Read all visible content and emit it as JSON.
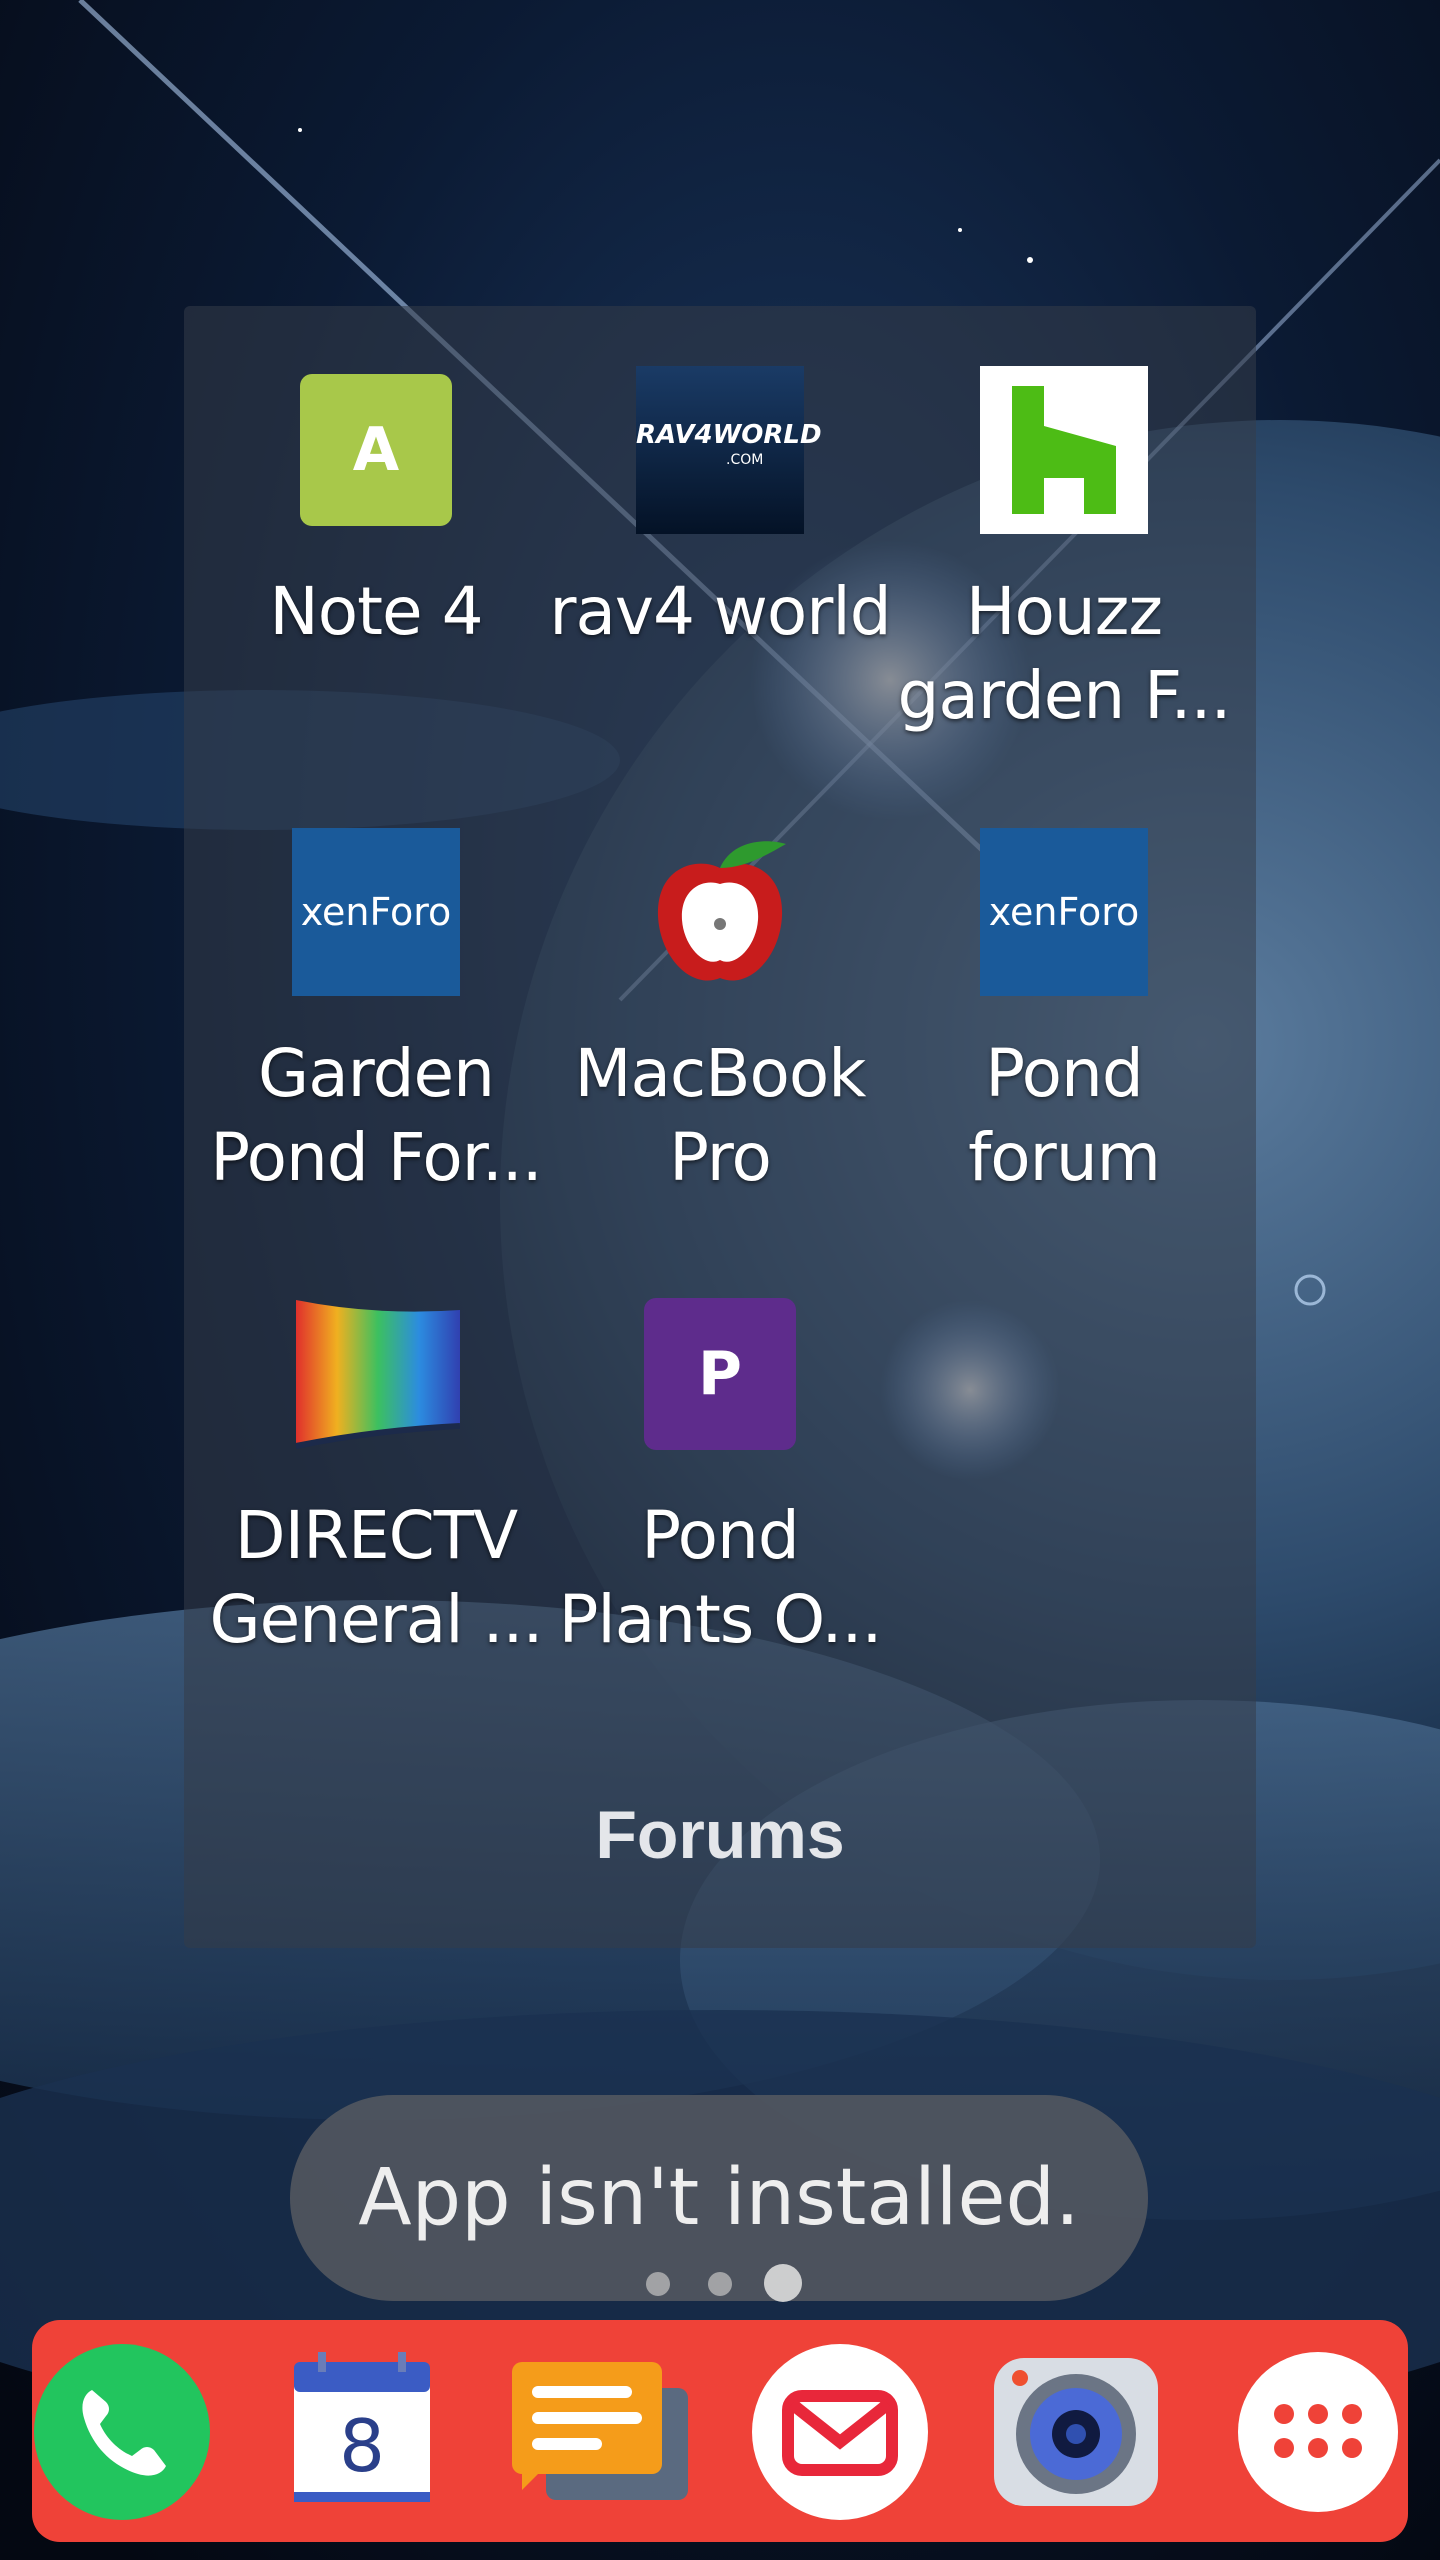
{
  "folder": {
    "name": "Forums",
    "apps": [
      {
        "label": "Note 4",
        "icon": "letter-a-icon",
        "letter": "A"
      },
      {
        "label": "rav4 world",
        "icon": "rav4world-icon",
        "logo_text": "RAV4WORLD",
        "logo_sub": ".COM"
      },
      {
        "label": "Houzz\ngarden F...",
        "icon": "houzz-icon"
      },
      {
        "label": "Garden\nPond For...",
        "icon": "xenforo-icon",
        "logo_text": "xenForo"
      },
      {
        "label": "MacBook\nPro",
        "icon": "apple-icon"
      },
      {
        "label": "Pond\nforum",
        "icon": "xenforo-icon",
        "logo_text": "xenForo"
      },
      {
        "label": "DIRECTV\nGeneral ...",
        "icon": "directv-icon"
      },
      {
        "label": "Pond\nPlants O...",
        "icon": "letter-p-icon",
        "letter": "P"
      }
    ]
  },
  "toast": {
    "message": "App isn't installed."
  },
  "page_indicator": {
    "count": 3,
    "current": 3
  },
  "dock": {
    "apps": [
      "phone-icon",
      "calendar-icon",
      "messages-icon",
      "email-icon",
      "camera-icon",
      "app-drawer-icon"
    ],
    "calendar_day": "8"
  },
  "colors": {
    "dock": "#ef4238",
    "note4_icon": "#a8c84a",
    "pond_plants_icon": "#5e2c8c",
    "xenforo": "#1a5a9a",
    "houzz": "#4dbc15"
  }
}
